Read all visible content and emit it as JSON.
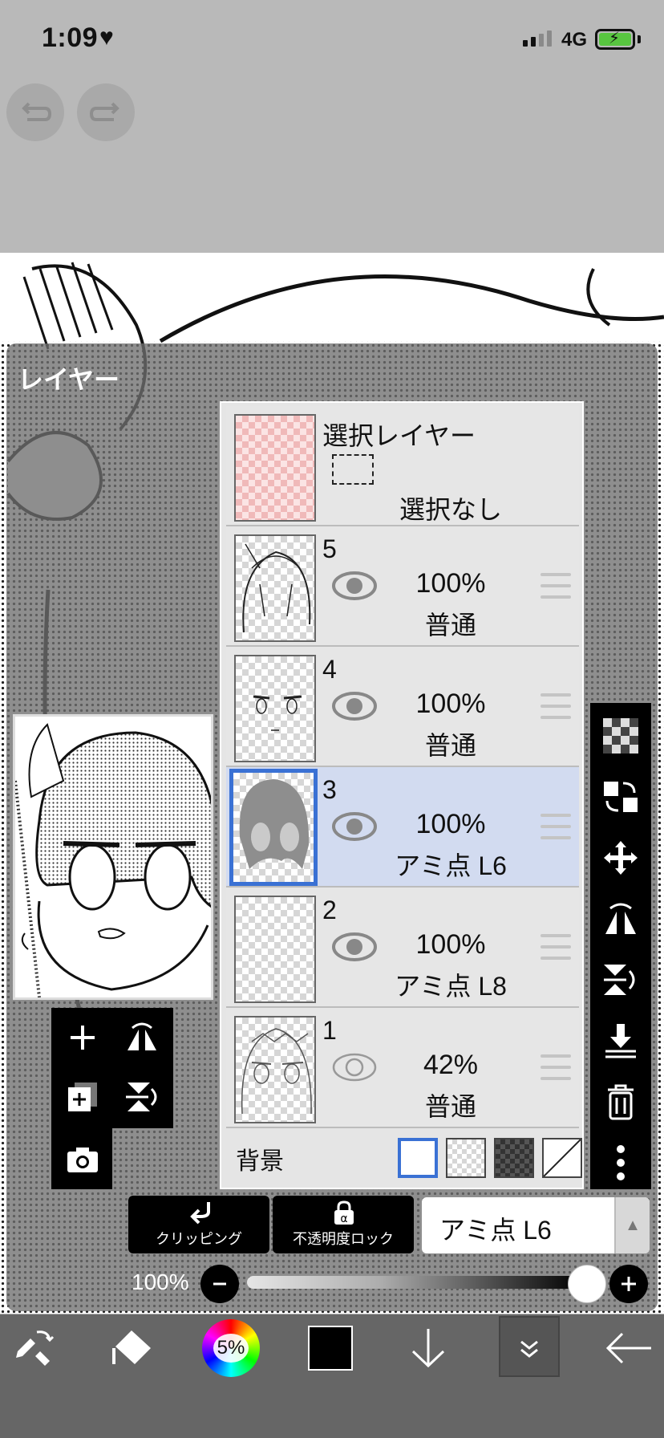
{
  "status": {
    "time": "1:09",
    "network": "4G"
  },
  "panel": {
    "title": "レイヤー"
  },
  "selection_layer": {
    "title": "選択レイヤー",
    "state": "選択なし"
  },
  "layers": [
    {
      "number": "5",
      "opacity": "100%",
      "blend": "普通",
      "visible": true,
      "selected": false
    },
    {
      "number": "4",
      "opacity": "100%",
      "blend": "普通",
      "visible": true,
      "selected": false
    },
    {
      "number": "3",
      "opacity": "100%",
      "blend": "アミ点 L6",
      "visible": true,
      "selected": true
    },
    {
      "number": "2",
      "opacity": "100%",
      "blend": "アミ点 L8",
      "visible": true,
      "selected": false
    },
    {
      "number": "1",
      "opacity": "42%",
      "blend": "普通",
      "visible": false,
      "selected": false
    }
  ],
  "background": {
    "label": "背景",
    "options": [
      "white",
      "transparent",
      "dark-checker",
      "none"
    ],
    "selected": "white"
  },
  "actions": {
    "clipping": "クリッピング",
    "opacity_lock": "不透明度ロック",
    "blend_mode": "アミ点 L6"
  },
  "opacity_slider": {
    "label": "100%",
    "value": 1.0
  },
  "bottom": {
    "brush_size_label": "5%",
    "current_color": "#000000"
  },
  "colors": {
    "selection_blue": "#3a71d4",
    "selected_row": "#d2dbf0"
  }
}
